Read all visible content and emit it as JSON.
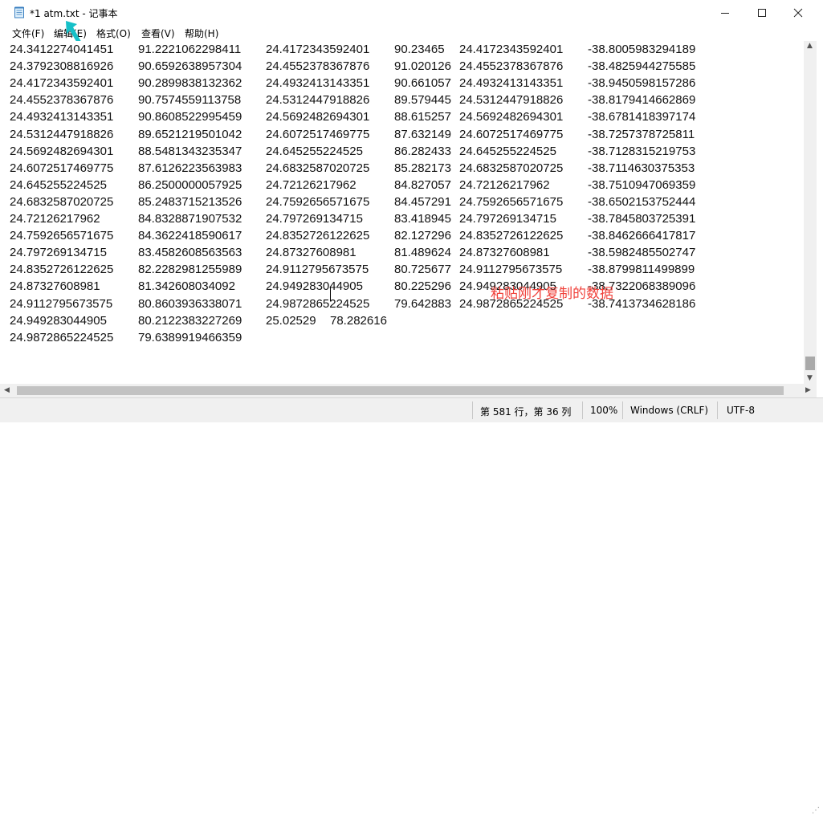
{
  "window": {
    "title": "*1 atm.txt - 记事本",
    "controls": {
      "minimize": "—",
      "maximize": "☐",
      "close": "✕"
    }
  },
  "menu": [
    {
      "label": "文件(F)"
    },
    {
      "label": "编辑(E)"
    },
    {
      "label": "格式(O)"
    },
    {
      "label": "查看(V)"
    },
    {
      "label": "帮助(H)"
    }
  ],
  "lines": [
    [
      "24.3412274041451",
      "91.2221062298411",
      "24.4172343592401",
      "90.23465",
      "24.4172343592401",
      "-38.8005983294189"
    ],
    [
      "24.3792308816926",
      "90.6592638957304",
      "24.4552378367876",
      "91.020126",
      "24.4552378367876",
      "-38.4825944275585"
    ],
    [
      "24.4172343592401",
      "90.2899838132362",
      "24.4932413143351",
      "90.661057",
      "24.4932413143351",
      "-38.9450598157286"
    ],
    [
      "24.4552378367876",
      "90.7574559113758",
      "24.5312447918826",
      "89.579445",
      "24.5312447918826",
      "-38.8179414662869"
    ],
    [
      "24.4932413143351",
      "90.8608522995459",
      "24.5692482694301",
      "88.615257",
      "24.5692482694301",
      "-38.6781418397174"
    ],
    [
      "24.5312447918826",
      "89.6521219501042",
      "24.6072517469775",
      "87.632149",
      "24.6072517469775",
      "-38.7257378725811"
    ],
    [
      "24.5692482694301",
      "88.5481343235347",
      "24.645255224525",
      "86.282433",
      "24.645255224525",
      "-38.7128315219753"
    ],
    [
      "24.6072517469775",
      "87.6126223563983",
      "24.6832587020725",
      "85.282173",
      "24.6832587020725",
      "-38.7114630375353"
    ],
    [
      "24.645255224525",
      "86.2500000057925",
      "24.72126217962",
      "84.827057",
      "24.72126217962",
      "-38.7510947069359"
    ],
    [
      "24.6832587020725",
      "85.2483715213526",
      "24.7592656571675",
      "84.457291",
      "24.7592656571675",
      "-38.6502153752444"
    ],
    [
      "24.72126217962",
      "84.8328871907532",
      "24.797269134715",
      "83.418945",
      "24.797269134715",
      "-38.7845803725391"
    ],
    [
      "24.7592656571675",
      "84.3622418590617",
      "24.8352726122625",
      "82.127296",
      "24.8352726122625",
      "-38.8462666417817"
    ],
    [
      "24.797269134715",
      "83.4582608563563",
      "24.87327608981",
      "81.489624",
      "24.87327608981",
      "-38.5982485502747"
    ],
    [
      "24.8352726122625",
      "82.2282981255989",
      "24.9112795673575",
      "80.725677",
      "24.9112795673575",
      "-38.8799811499899"
    ],
    [
      "24.87327608981",
      "81.342608034092",
      "24.949283044905",
      "80.225296",
      "24.949283044905",
      "-38.7322068389096"
    ],
    [
      "24.9112795673575",
      "80.8603936338071",
      "24.9872865224525",
      "79.642883",
      "24.9872865224525",
      "-38.7413734628186"
    ],
    [
      "24.949283044905",
      "80.2122383227269",
      "25.02529",
      "78.282616",
      "",
      ""
    ],
    [
      "24.9872865224525",
      "79.6389919466359",
      "",
      "",
      "",
      ""
    ]
  ],
  "annotation": "粘贴刚才复制的数据",
  "status": {
    "position": "第 581 行，第 36 列",
    "zoom": "100%",
    "line_ending": "Windows (CRLF)",
    "encoding": "UTF-8"
  },
  "colors": {
    "annotation": "#f0413a",
    "cursor_arrow": "#16c0c8"
  }
}
